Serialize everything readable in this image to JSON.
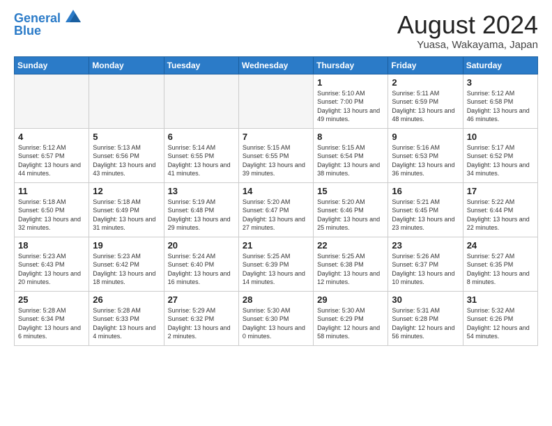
{
  "logo": {
    "line1": "General",
    "line2": "Blue"
  },
  "title": "August 2024",
  "subtitle": "Yuasa, Wakayama, Japan",
  "days_of_week": [
    "Sunday",
    "Monday",
    "Tuesday",
    "Wednesday",
    "Thursday",
    "Friday",
    "Saturday"
  ],
  "weeks": [
    [
      {
        "day": "",
        "empty": true
      },
      {
        "day": "",
        "empty": true
      },
      {
        "day": "",
        "empty": true
      },
      {
        "day": "",
        "empty": true
      },
      {
        "day": "1",
        "sunrise": "5:10 AM",
        "sunset": "7:00 PM",
        "daylight": "13 hours and 49 minutes."
      },
      {
        "day": "2",
        "sunrise": "5:11 AM",
        "sunset": "6:59 PM",
        "daylight": "13 hours and 48 minutes."
      },
      {
        "day": "3",
        "sunrise": "5:12 AM",
        "sunset": "6:58 PM",
        "daylight": "13 hours and 46 minutes."
      }
    ],
    [
      {
        "day": "4",
        "sunrise": "5:12 AM",
        "sunset": "6:57 PM",
        "daylight": "13 hours and 44 minutes."
      },
      {
        "day": "5",
        "sunrise": "5:13 AM",
        "sunset": "6:56 PM",
        "daylight": "13 hours and 43 minutes."
      },
      {
        "day": "6",
        "sunrise": "5:14 AM",
        "sunset": "6:55 PM",
        "daylight": "13 hours and 41 minutes."
      },
      {
        "day": "7",
        "sunrise": "5:15 AM",
        "sunset": "6:55 PM",
        "daylight": "13 hours and 39 minutes."
      },
      {
        "day": "8",
        "sunrise": "5:15 AM",
        "sunset": "6:54 PM",
        "daylight": "13 hours and 38 minutes."
      },
      {
        "day": "9",
        "sunrise": "5:16 AM",
        "sunset": "6:53 PM",
        "daylight": "13 hours and 36 minutes."
      },
      {
        "day": "10",
        "sunrise": "5:17 AM",
        "sunset": "6:52 PM",
        "daylight": "13 hours and 34 minutes."
      }
    ],
    [
      {
        "day": "11",
        "sunrise": "5:18 AM",
        "sunset": "6:50 PM",
        "daylight": "13 hours and 32 minutes."
      },
      {
        "day": "12",
        "sunrise": "5:18 AM",
        "sunset": "6:49 PM",
        "daylight": "13 hours and 31 minutes."
      },
      {
        "day": "13",
        "sunrise": "5:19 AM",
        "sunset": "6:48 PM",
        "daylight": "13 hours and 29 minutes."
      },
      {
        "day": "14",
        "sunrise": "5:20 AM",
        "sunset": "6:47 PM",
        "daylight": "13 hours and 27 minutes."
      },
      {
        "day": "15",
        "sunrise": "5:20 AM",
        "sunset": "6:46 PM",
        "daylight": "13 hours and 25 minutes."
      },
      {
        "day": "16",
        "sunrise": "5:21 AM",
        "sunset": "6:45 PM",
        "daylight": "13 hours and 23 minutes."
      },
      {
        "day": "17",
        "sunrise": "5:22 AM",
        "sunset": "6:44 PM",
        "daylight": "13 hours and 22 minutes."
      }
    ],
    [
      {
        "day": "18",
        "sunrise": "5:23 AM",
        "sunset": "6:43 PM",
        "daylight": "13 hours and 20 minutes."
      },
      {
        "day": "19",
        "sunrise": "5:23 AM",
        "sunset": "6:42 PM",
        "daylight": "13 hours and 18 minutes."
      },
      {
        "day": "20",
        "sunrise": "5:24 AM",
        "sunset": "6:40 PM",
        "daylight": "13 hours and 16 minutes."
      },
      {
        "day": "21",
        "sunrise": "5:25 AM",
        "sunset": "6:39 PM",
        "daylight": "13 hours and 14 minutes."
      },
      {
        "day": "22",
        "sunrise": "5:25 AM",
        "sunset": "6:38 PM",
        "daylight": "13 hours and 12 minutes."
      },
      {
        "day": "23",
        "sunrise": "5:26 AM",
        "sunset": "6:37 PM",
        "daylight": "13 hours and 10 minutes."
      },
      {
        "day": "24",
        "sunrise": "5:27 AM",
        "sunset": "6:35 PM",
        "daylight": "13 hours and 8 minutes."
      }
    ],
    [
      {
        "day": "25",
        "sunrise": "5:28 AM",
        "sunset": "6:34 PM",
        "daylight": "13 hours and 6 minutes."
      },
      {
        "day": "26",
        "sunrise": "5:28 AM",
        "sunset": "6:33 PM",
        "daylight": "13 hours and 4 minutes."
      },
      {
        "day": "27",
        "sunrise": "5:29 AM",
        "sunset": "6:32 PM",
        "daylight": "13 hours and 2 minutes."
      },
      {
        "day": "28",
        "sunrise": "5:30 AM",
        "sunset": "6:30 PM",
        "daylight": "13 hours and 0 minutes."
      },
      {
        "day": "29",
        "sunrise": "5:30 AM",
        "sunset": "6:29 PM",
        "daylight": "12 hours and 58 minutes."
      },
      {
        "day": "30",
        "sunrise": "5:31 AM",
        "sunset": "6:28 PM",
        "daylight": "12 hours and 56 minutes."
      },
      {
        "day": "31",
        "sunrise": "5:32 AM",
        "sunset": "6:26 PM",
        "daylight": "12 hours and 54 minutes."
      }
    ]
  ]
}
